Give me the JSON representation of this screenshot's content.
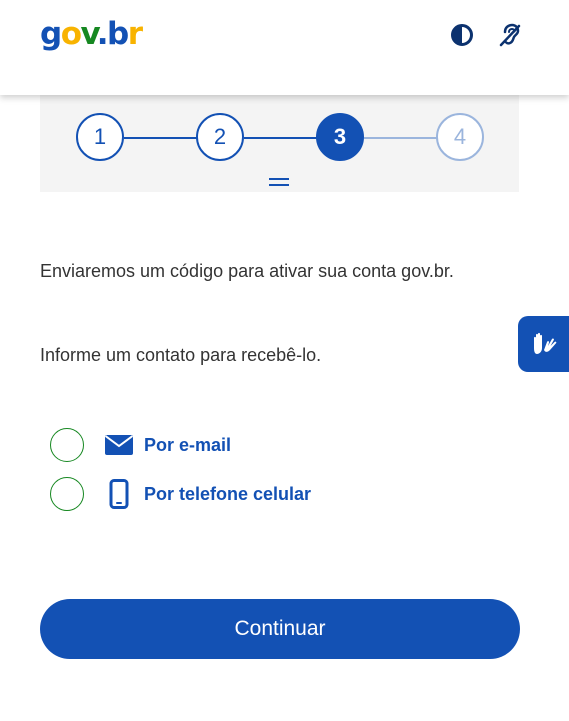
{
  "header": {
    "logo": {
      "g": "g",
      "o": "o",
      "v": "v",
      "dot": ".",
      "b": "b",
      "r": "r"
    },
    "contrast_icon": "contrast-icon",
    "accessibility_icon": "hearing-impaired-icon"
  },
  "stepper": {
    "steps": [
      "1",
      "2",
      "3",
      "4"
    ],
    "current_step": 3
  },
  "main": {
    "paragraph_1": "Enviaremos um código para ativar sua conta gov.br.",
    "paragraph_2": "Informe um contato para recebê-lo."
  },
  "options": [
    {
      "label": "Por e-mail",
      "icon": "envelope-icon",
      "selected": false
    },
    {
      "label": "Por telefone celular",
      "icon": "mobile-phone-icon",
      "selected": false
    }
  ],
  "continue_label": "Continuar",
  "vlibras_icon": "sign-language-hands-icon",
  "colors": {
    "primary": "#1351b4",
    "radio_border": "#168821",
    "logo_blue": "#1351b4",
    "logo_yellow": "#f8b300",
    "logo_green": "#168821"
  }
}
